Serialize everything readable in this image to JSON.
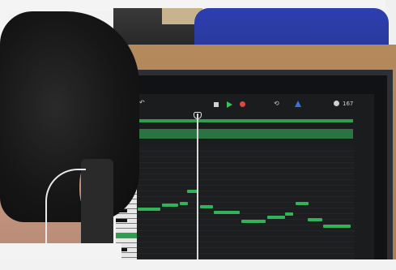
{
  "scene": {
    "description_label": "",
    "tablet_app": {
      "toolbar": {
        "undo_icon": "undo-icon",
        "stop_icon": "stop-icon",
        "play_icon": "play-icon",
        "record_icon": "record-icon",
        "cycle_icon": "cycle-icon",
        "metronome_icon": "metronome-icon",
        "info_icon": "info-icon",
        "counter_text": "167"
      },
      "notes": [
        {
          "row": 0,
          "col": 0
        },
        {
          "row": 1,
          "col": 1
        },
        {
          "row": 2,
          "col": 2
        },
        {
          "row": 3,
          "col": 3
        },
        {
          "row": 4,
          "col": 4
        }
      ]
    },
    "colors": {
      "note_green": "#32b35a",
      "chair_blue": "#2d3fb0",
      "desk_wood": "#b48a5c"
    }
  }
}
